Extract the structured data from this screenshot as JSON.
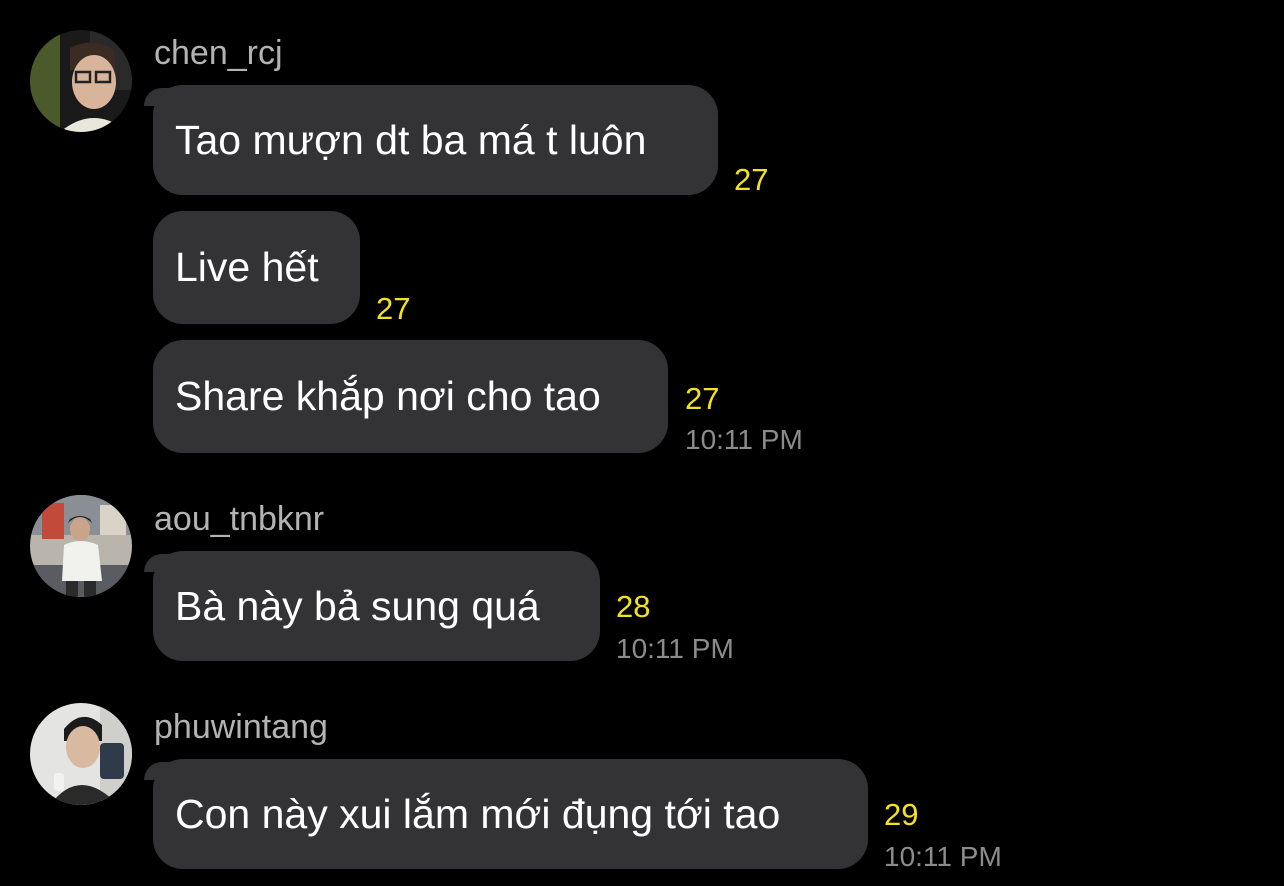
{
  "colors": {
    "background": "#000000",
    "bubble": "#333335",
    "message_text": "#ffffff",
    "username": "#b3b3b3",
    "count": "#f3e21f",
    "timestamp": "#8c8c8c"
  },
  "groups": [
    {
      "username": "chen_rcj",
      "avatar": "profile-photo-icon",
      "messages": [
        {
          "text": "Tao mượn dt ba má t luôn",
          "count": "27"
        },
        {
          "text": "Live hết",
          "count": "27"
        },
        {
          "text": "Share khắp nơi cho tao",
          "count": "27",
          "time": "10:11 PM"
        }
      ]
    },
    {
      "username": "aou_tnbknr",
      "avatar": "profile-photo-icon",
      "messages": [
        {
          "text": "Bà này bả sung quá",
          "count": "28",
          "time": "10:11 PM"
        }
      ]
    },
    {
      "username": "phuwintang",
      "avatar": "profile-photo-icon",
      "messages": [
        {
          "text": "Con này xui lắm mới đụng tới tao",
          "count": "29",
          "time": "10:11 PM"
        }
      ]
    }
  ]
}
